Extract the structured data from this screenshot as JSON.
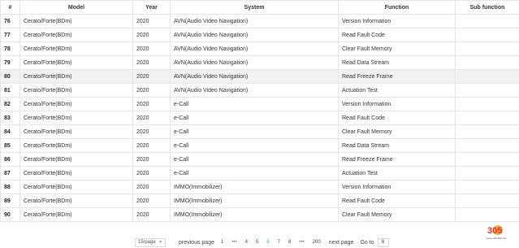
{
  "table": {
    "headers": [
      "#",
      "Model",
      "Year",
      "System",
      "Function",
      "Sub function"
    ],
    "rows": [
      [
        "76",
        "Cerato/Forte(BDm)",
        "2020",
        "AVN(Audio Video Navigation)",
        "Version Information",
        ""
      ],
      [
        "77",
        "Cerato/Forte(BDm)",
        "2020",
        "AVN(Audio Video Navigation)",
        "Read Fault Code",
        ""
      ],
      [
        "78",
        "Cerato/Forte(BDm)",
        "2020",
        "AVN(Audio Video Navigation)",
        "Clear Fault Memory",
        ""
      ],
      [
        "79",
        "Cerato/Forte(BDm)",
        "2020",
        "AVN(Audio Video Navigation)",
        "Read Data Stream",
        ""
      ],
      [
        "80",
        "Cerato/Forte(BDm)",
        "2020",
        "AVN(Audio Video Navigation)",
        "Read Freeze Frame",
        ""
      ],
      [
        "81",
        "Cerato/Forte(BDm)",
        "2020",
        "AVN(Audio Video Navigation)",
        "Actuation Test",
        ""
      ],
      [
        "82",
        "Cerato/Forte(BDm)",
        "2020",
        "e-Call",
        "Version Information",
        ""
      ],
      [
        "83",
        "Cerato/Forte(BDm)",
        "2020",
        "e-Call",
        "Read Fault Code",
        ""
      ],
      [
        "84",
        "Cerato/Forte(BDm)",
        "2020",
        "e-Call",
        "Clear Fault Memory",
        ""
      ],
      [
        "85",
        "Cerato/Forte(BDm)",
        "2020",
        "e-Call",
        "Read Data Stream",
        ""
      ],
      [
        "86",
        "Cerato/Forte(BDm)",
        "2020",
        "e-Call",
        "Read Freeze Frame",
        ""
      ],
      [
        "87",
        "Cerato/Forte(BDm)",
        "2020",
        "e-Call",
        "Actuation Test",
        ""
      ],
      [
        "88",
        "Cerato/Forte(BDm)",
        "2020",
        "IMMO(Immobilizer)",
        "Version Information",
        ""
      ],
      [
        "89",
        "Cerato/Forte(BDm)",
        "2020",
        "IMMO(Immobilizer)",
        "Read Fault Code",
        ""
      ],
      [
        "90",
        "Cerato/Forte(BDm)",
        "2020",
        "IMMO(Immobilizer)",
        "Clear Fault Memory",
        ""
      ]
    ],
    "highlighted_row": "80"
  },
  "pager": {
    "page_size": "15/page",
    "prev_label": "previous page",
    "pages": [
      "1",
      "•••",
      "4",
      "5",
      "6",
      "7",
      "8",
      "•••",
      "200"
    ],
    "active_page": "6",
    "next_label": "next page",
    "goto_label": "Go to",
    "goto_value": "6"
  },
  "watermark": {
    "text": "305",
    "site": "www.obdii365.com"
  },
  "colors": {
    "accent": "#4b9be6",
    "border": "#e6e6e6",
    "highlight": "#f2f2f2"
  }
}
